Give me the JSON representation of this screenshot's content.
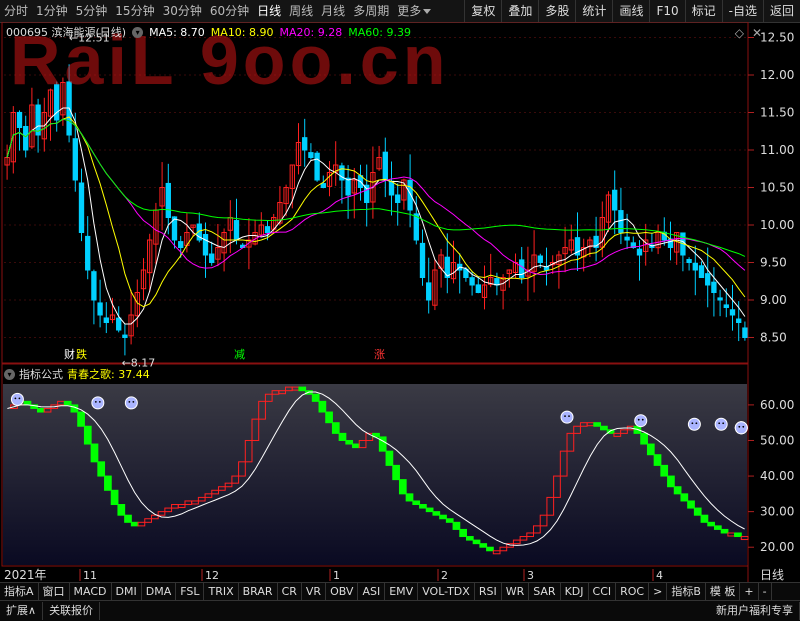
{
  "toolbar": {
    "periods": [
      "分时",
      "1分钟",
      "5分钟",
      "15分钟",
      "30分钟",
      "60分钟",
      "日线",
      "周线",
      "月线",
      "多周期",
      "更多"
    ],
    "buttons": [
      "复权",
      "叠加",
      "多股",
      "统计",
      "画线",
      "F10",
      "标记",
      "-自选",
      "返回"
    ]
  },
  "stock": {
    "code_name": "000695 滨海能源(日线)"
  },
  "ma_legend": [
    {
      "label": "MA5: 8.70",
      "color": "#ffffff"
    },
    {
      "label": "MA10: 8.90",
      "color": "#ffff00"
    },
    {
      "label": "MA20: 9.28",
      "color": "#ff00ff"
    },
    {
      "label": "MA60: 9.39",
      "color": "#00ff00"
    }
  ],
  "watermark": "RaiL 9oo.cn",
  "indicator": {
    "title": "指标公式",
    "name": "青春之歌",
    "value": "37.44",
    "label": "青春之歌: 37.44"
  },
  "event_labels": [
    {
      "text": "财",
      "color": "#ffffff"
    },
    {
      "text": "跌",
      "color": "#ffff00"
    },
    {
      "text": "减",
      "color": "#00ff00"
    },
    {
      "text": "涨",
      "color": "#ff3333"
    }
  ],
  "price_markers": {
    "high": "12.51",
    "low": "8.17"
  },
  "x_axis": {
    "year": "2021年",
    "months": [
      "11",
      "12",
      "1",
      "2",
      "3",
      "4"
    ],
    "period": "日线"
  },
  "indicator_tabs": [
    "指标A",
    "窗口",
    "MACD",
    "DMI",
    "DMA",
    "FSL",
    "TRIX",
    "BRAR",
    "CR",
    "VR",
    "OBV",
    "ASI",
    "EMV",
    "VOL-TDX",
    "RSI",
    "WR",
    "SAR",
    "KDJ",
    "CCI",
    "ROC",
    ">",
    "指标B",
    "模 板",
    "+",
    "-"
  ],
  "status_bar": [
    "扩展∧",
    "关联报价",
    "新用户福利专享"
  ],
  "colors": {
    "up": "#ff2020",
    "down": "#00d0ff",
    "ma5": "#ffffff",
    "ma10": "#ffff00",
    "ma20": "#ff00ff",
    "ma60": "#00ff00",
    "ind_up": "#ff2020",
    "ind_down": "#00ff00"
  },
  "chart_data": [
    {
      "type": "candlestick",
      "title": "000695 滨海能源(日线)",
      "ylim": [
        8.2,
        12.6
      ],
      "y_ticks": [
        8.5,
        9.0,
        9.5,
        10.0,
        10.5,
        11.0,
        11.5,
        12.0,
        12.5
      ],
      "annotations": [
        "12.51",
        "8.17"
      ],
      "close": [
        10.9,
        11.5,
        11.3,
        11.0,
        11.6,
        11.2,
        11.5,
        11.8,
        11.4,
        11.9,
        11.2,
        10.6,
        9.9,
        9.4,
        9.0,
        8.8,
        8.7,
        8.8,
        8.6,
        8.5,
        8.8,
        9.1,
        9.4,
        9.8,
        10.2,
        10.5,
        10.1,
        9.8,
        9.7,
        9.9,
        10.0,
        9.8,
        9.6,
        9.5,
        9.7,
        9.9,
        10.1,
        9.8,
        9.7,
        9.8,
        9.9,
        10.0,
        9.9,
        10.1,
        10.3,
        10.5,
        10.8,
        11.1,
        11.0,
        10.9,
        10.6,
        10.5,
        10.7,
        10.8,
        10.6,
        10.4,
        10.6,
        10.5,
        10.3,
        10.7,
        10.9,
        10.6,
        10.4,
        10.3,
        10.6,
        10.2,
        9.8,
        9.3,
        9.0,
        9.4,
        9.6,
        9.3,
        9.5,
        9.4,
        9.3,
        9.2,
        9.1,
        9.2,
        9.3,
        9.2,
        9.3,
        9.4,
        9.5,
        9.3,
        9.4,
        9.6,
        9.5,
        9.4,
        9.5,
        9.6,
        9.7,
        9.8,
        9.6,
        9.7,
        9.8,
        9.7,
        10.1,
        10.4,
        10.2,
        9.9,
        9.8,
        9.7,
        9.6,
        9.8,
        9.7,
        9.9,
        9.8,
        9.7,
        9.9,
        9.6,
        9.5,
        9.4,
        9.3,
        9.2,
        9.1,
        9.0,
        8.9,
        8.8,
        8.7,
        8.5
      ]
    },
    {
      "type": "area",
      "title": "青春之歌",
      "ylim": [
        15,
        67
      ],
      "y_ticks": [
        20.0,
        30.0,
        40.0,
        50.0,
        60.0
      ],
      "values": [
        59,
        60,
        61,
        60,
        59,
        58,
        59,
        60,
        61,
        60,
        58,
        54,
        49,
        44,
        40,
        36,
        32,
        29,
        27,
        26,
        27,
        28,
        29,
        30,
        31,
        32,
        32,
        33,
        33,
        34,
        35,
        36,
        37,
        38,
        40,
        44,
        50,
        56,
        61,
        63,
        64,
        64,
        65,
        65,
        64,
        63,
        61,
        58,
        55,
        52,
        50,
        49,
        48,
        50,
        52,
        51,
        47,
        43,
        39,
        35,
        33,
        32,
        31,
        30,
        29,
        28,
        27,
        25,
        23,
        22,
        21,
        20,
        19,
        19,
        20,
        21,
        22,
        23,
        24,
        26,
        29,
        34,
        40,
        47,
        52,
        54,
        55,
        55,
        54,
        53,
        52,
        52,
        53,
        54,
        52,
        49,
        46,
        43,
        40,
        37,
        35,
        33,
        31,
        29,
        27,
        26,
        25,
        24,
        24,
        23,
        23
      ]
    }
  ]
}
